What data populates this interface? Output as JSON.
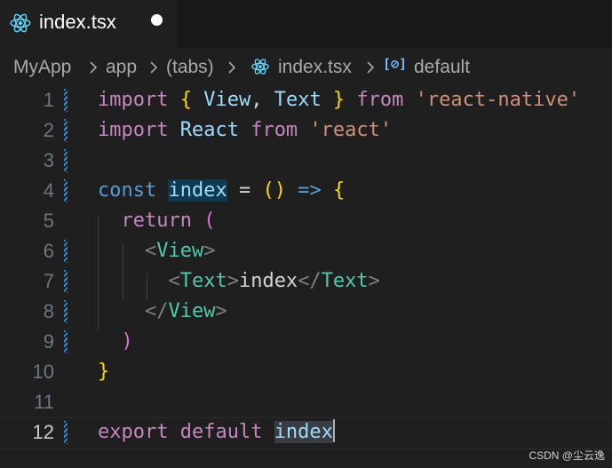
{
  "tab": {
    "filename": "index.tsx"
  },
  "breadcrumb": {
    "items": [
      "MyApp",
      "app",
      "(tabs)",
      "index.tsx",
      "default"
    ]
  },
  "editor": {
    "line_numbers": [
      "1",
      "2",
      "3",
      "4",
      "5",
      "6",
      "7",
      "8",
      "9",
      "10",
      "11",
      "12"
    ],
    "lines": [
      [
        {
          "t": "import ",
          "c": "kw"
        },
        {
          "t": "{ ",
          "c": "br1"
        },
        {
          "t": "View",
          "c": "var"
        },
        {
          "t": ", ",
          "c": "plain"
        },
        {
          "t": "Text",
          "c": "var"
        },
        {
          "t": " }",
          "c": "br1"
        },
        {
          "t": " from ",
          "c": "kw"
        },
        {
          "t": "'react-native'",
          "c": "str"
        }
      ],
      [
        {
          "t": "import ",
          "c": "kw"
        },
        {
          "t": "React",
          "c": "var"
        },
        {
          "t": " from ",
          "c": "kw"
        },
        {
          "t": "'react'",
          "c": "str"
        }
      ],
      [],
      [
        {
          "t": "const ",
          "c": "ks"
        },
        {
          "t": "index",
          "c": "var hl"
        },
        {
          "t": " = ",
          "c": "plain"
        },
        {
          "t": "()",
          "c": "br1"
        },
        {
          "t": " => ",
          "c": "ks"
        },
        {
          "t": "{",
          "c": "br1"
        }
      ],
      [
        {
          "t": "  return ",
          "c": "kw"
        },
        {
          "t": "(",
          "c": "br2"
        }
      ],
      [
        {
          "t": "    <",
          "c": "tag"
        },
        {
          "t": "View",
          "c": "cmp"
        },
        {
          "t": ">",
          "c": "tag"
        }
      ],
      [
        {
          "t": "      <",
          "c": "tag"
        },
        {
          "t": "Text",
          "c": "cmp"
        },
        {
          "t": ">",
          "c": "tag"
        },
        {
          "t": "index",
          "c": "plain"
        },
        {
          "t": "</",
          "c": "tag"
        },
        {
          "t": "Text",
          "c": "cmp"
        },
        {
          "t": ">",
          "c": "tag"
        }
      ],
      [
        {
          "t": "    </",
          "c": "tag"
        },
        {
          "t": "View",
          "c": "cmp"
        },
        {
          "t": ">",
          "c": "tag"
        }
      ],
      [
        {
          "t": "  )",
          "c": "br2"
        }
      ],
      [
        {
          "t": "}",
          "c": "br1"
        }
      ],
      [],
      [
        {
          "t": "export ",
          "c": "kw"
        },
        {
          "t": "default ",
          "c": "kw"
        },
        {
          "t": "index",
          "c": "var hl2"
        }
      ]
    ],
    "modified_lines": [
      1,
      2,
      3,
      4,
      6,
      7,
      8,
      9,
      12
    ]
  },
  "watermark": "CSDN @尘云逸",
  "colors": {
    "accent_blue": "#2e8fd6",
    "react_icon": "#61dafb",
    "keyword": "#c586c0",
    "string": "#ce9178"
  }
}
